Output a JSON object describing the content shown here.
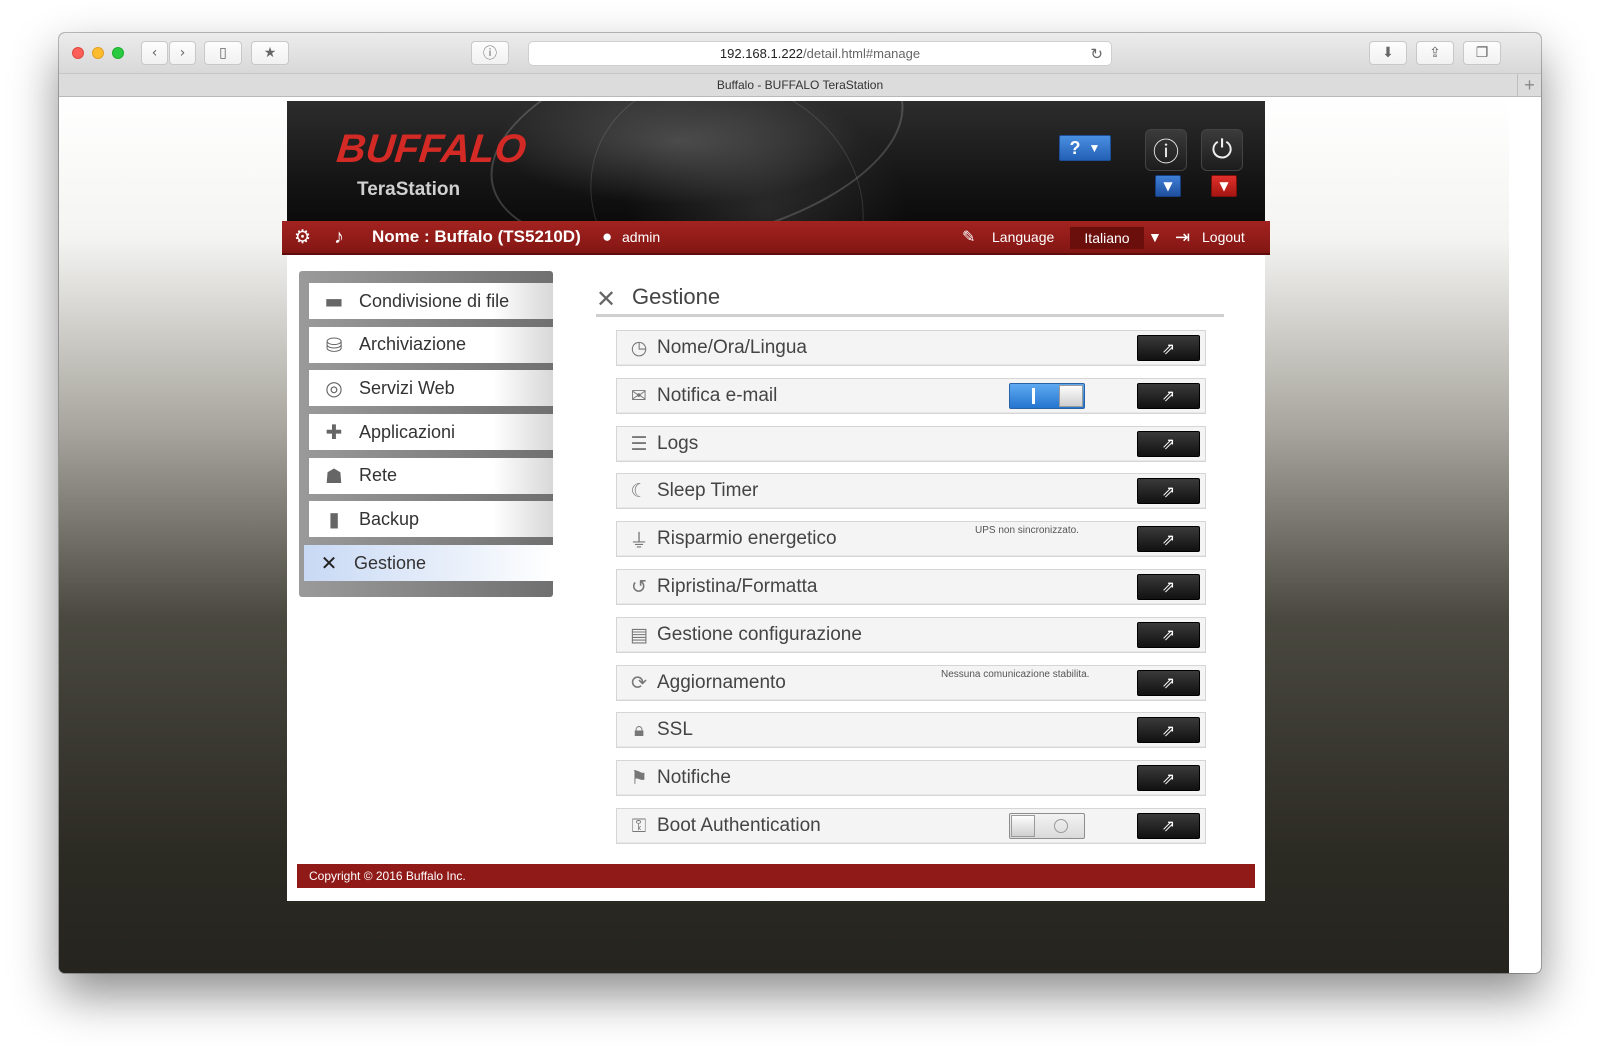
{
  "browser": {
    "url_host": "192.168.1.222",
    "url_path": "/detail.html#manage",
    "tab_title": "Buffalo - BUFFALO TeraStation",
    "back_icon": "chevron-left-icon",
    "forward_icon": "chevron-right-icon"
  },
  "header": {
    "brand": "BUFFALO",
    "product": "TeraStation",
    "help_label": "?"
  },
  "topbar": {
    "nas_name": "Nome : Buffalo (TS5210D)",
    "user": "admin",
    "language_label": "Language",
    "language_value": "Italiano",
    "logout_label": "Logout"
  },
  "sidebar": {
    "items": [
      {
        "label": "Condivisione di file",
        "icon": "folder-icon"
      },
      {
        "label": "Archiviazione",
        "icon": "database-icon"
      },
      {
        "label": "Servizi Web",
        "icon": "web-services-icon"
      },
      {
        "label": "Applicazioni",
        "icon": "applications-icon"
      },
      {
        "label": "Rete",
        "icon": "network-icon"
      },
      {
        "label": "Backup",
        "icon": "backup-icon"
      },
      {
        "label": "Gestione",
        "icon": "tools-icon",
        "active": true
      }
    ]
  },
  "content": {
    "title": "Gestione",
    "rows": [
      {
        "label": "Nome/Ora/Lingua",
        "icon": "clock-icon"
      },
      {
        "label": "Notifica e-mail",
        "icon": "envelope-icon",
        "toggle": "on"
      },
      {
        "label": "Logs",
        "icon": "log-icon"
      },
      {
        "label": "Sleep Timer",
        "icon": "sleep-timer-icon"
      },
      {
        "label": "Risparmio energetico",
        "icon": "plug-icon",
        "note": "UPS non sincronizzato."
      },
      {
        "label": "Ripristina/Formatta",
        "icon": "restore-icon"
      },
      {
        "label": "Gestione configurazione",
        "icon": "config-icon"
      },
      {
        "label": "Aggiornamento",
        "icon": "update-icon",
        "note": "Nessuna comunicazione stabilita."
      },
      {
        "label": "SSL",
        "icon": "lock-icon"
      },
      {
        "label": "Notifiche",
        "icon": "notification-icon"
      },
      {
        "label": "Boot Authentication",
        "icon": "boot-auth-icon",
        "toggle": "off"
      }
    ]
  },
  "footer": {
    "copyright": "Copyright © 2016 Buffalo Inc."
  },
  "colors": {
    "brand_red": "#d42a26",
    "bar_red": "#8f1a18",
    "toggle_on": "#2575cf",
    "active_menu": "#c8d9f5"
  }
}
